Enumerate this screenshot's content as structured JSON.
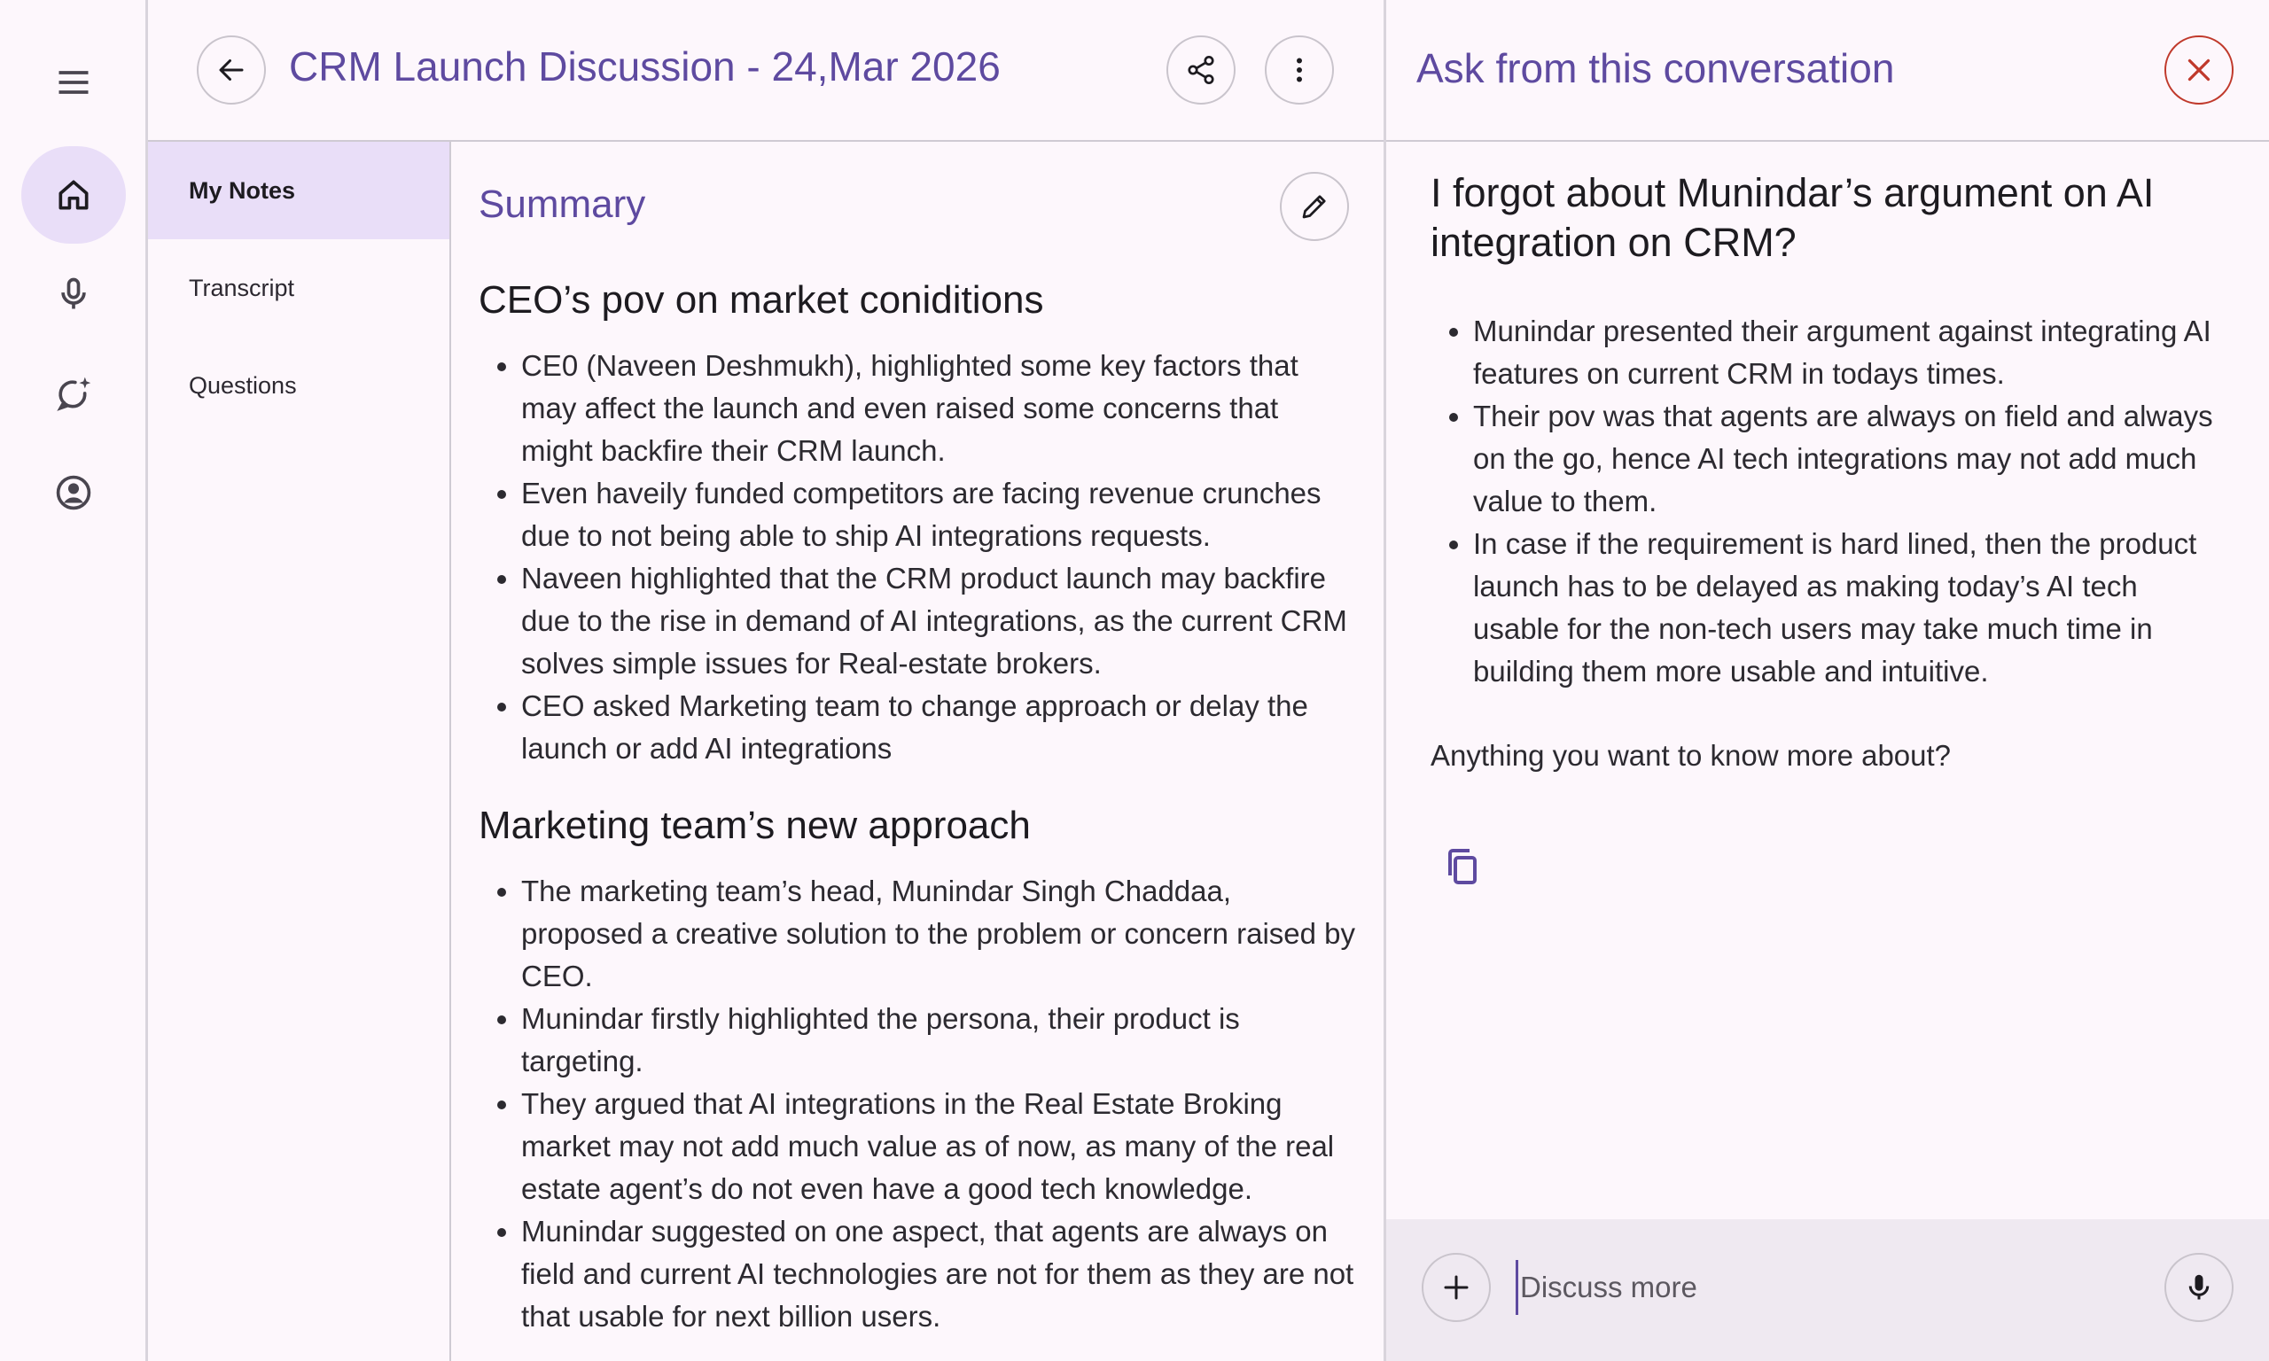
{
  "header": {
    "title": "CRM Launch Discussion - 24,Mar 2026",
    "back_icon": "arrow-left-icon",
    "share_icon": "share-icon",
    "more_icon": "more-vertical-icon"
  },
  "rail": {
    "items": [
      {
        "icon": "menu-icon"
      },
      {
        "icon": "home-icon",
        "active": true
      },
      {
        "icon": "mic-icon"
      },
      {
        "icon": "chat-sparkle-icon"
      },
      {
        "icon": "account-icon"
      }
    ]
  },
  "tabs": [
    {
      "label": "My Notes",
      "active": true
    },
    {
      "label": "Transcript"
    },
    {
      "label": "Questions"
    }
  ],
  "notes": {
    "summary_label": "Summary",
    "edit_icon": "pencil-icon",
    "sections": [
      {
        "heading": "CEO’s pov on market coniditions",
        "bullets": [
          "CE0 (Naveen Deshmukh), highlighted some key factors that may affect the launch and even raised some concerns that might backfire their CRM launch.",
          "Even haveily funded competitors are facing revenue crunches due to not being able to ship AI integrations requests.",
          "Naveen highlighted that the CRM product launch may backfire due to the rise in demand of AI integrations, as the current CRM solves simple issues for Real-estate brokers.",
          "CEO asked Marketing team to change approach or delay the launch or add AI integrations"
        ]
      },
      {
        "heading": "Marketing team’s new approach",
        "bullets": [
          "The marketing team’s head, Munindar Singh Chaddaa, proposed a creative solution to the problem or concern raised by CEO.",
          "Munindar firstly highlighted the persona, their product is targeting.",
          "They argued that AI integrations in the Real Estate Broking market may not add much value as of now, as many of the real estate agent’s do not even have a good tech knowledge.",
          "Munindar suggested on one aspect, that agents are always on field and current AI technologies are not for them as they are not that usable for next billion users."
        ]
      }
    ]
  },
  "chat": {
    "title": "Ask from this conversation",
    "question": "I forgot about Munindar’s argument on AI integration on CRM?",
    "answer_bullets": [
      "Munindar presented their argument against integrating AI features on current CRM in todays times.",
      "Their pov was that agents are always on field and always on the go, hence AI tech integrations may not add much value to them.",
      "In case if the requirement is hard lined, then the product launch has to be delayed as making today’s AI tech usable for the non-tech users may take much time in building them more usable and intuitive."
    ],
    "followup": "Anything you want to know more about?",
    "input_placeholder": "Discuss more",
    "accent_color": "#5e4aa0",
    "close_color": "#c0392b"
  }
}
